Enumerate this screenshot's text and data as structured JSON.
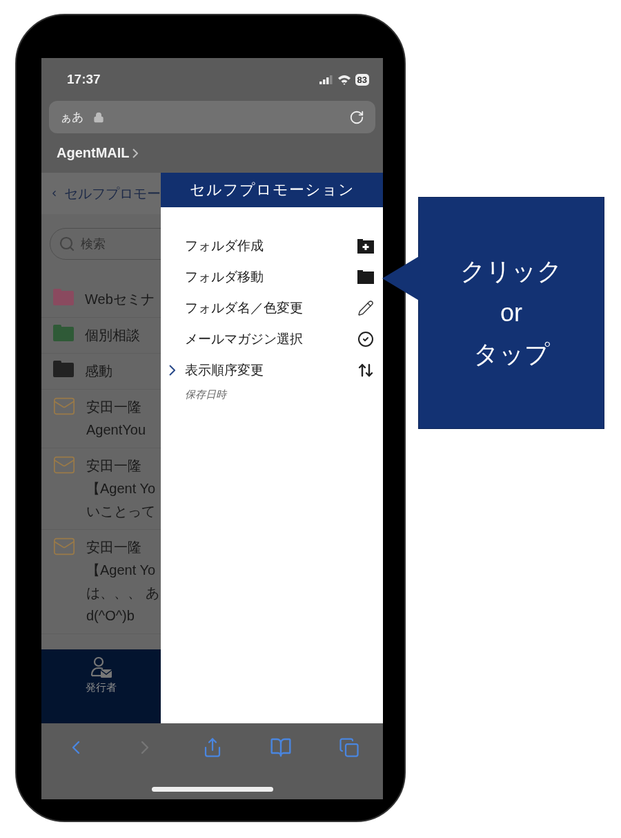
{
  "status_bar": {
    "time": "17:37",
    "battery": "83"
  },
  "browser": {
    "address_text": "ぁあ",
    "back_link": "AgentMAIL"
  },
  "page": {
    "header_title": "セルフプロモー",
    "search": {
      "placeholder": "検索"
    },
    "items": [
      {
        "kind": "folder",
        "color": "#8a4a5f",
        "lines": [
          "Webセミナ"
        ]
      },
      {
        "kind": "folder",
        "color": "#2f5a37",
        "lines": [
          "個別相談"
        ]
      },
      {
        "kind": "folder",
        "color": "#222222",
        "lines": [
          "感動"
        ]
      },
      {
        "kind": "mail",
        "lines": [
          "安田一隆",
          "AgentYou"
        ]
      },
      {
        "kind": "mail",
        "lines": [
          "安田一隆",
          "【Agent Yo",
          "いことって"
        ]
      },
      {
        "kind": "mail",
        "lines": [
          "安田一隆",
          "【Agent Yo",
          "は、、、 あ",
          "d(^O^)b"
        ]
      }
    ],
    "bottom_nav": [
      {
        "label": "発行者"
      }
    ]
  },
  "drawer": {
    "title": "セルフプロモーション",
    "items": [
      {
        "label": "フォルダ作成",
        "selected": false
      },
      {
        "label": "フォルダ移動",
        "selected": false
      },
      {
        "label": "フォルダ名／色変更",
        "selected": false
      },
      {
        "label": "メールマガジン選択",
        "selected": false
      },
      {
        "label": "表示順序変更",
        "selected": true
      }
    ],
    "footer": "保存日時"
  },
  "callout": {
    "lines": [
      "クリック",
      "or",
      "タップ"
    ]
  }
}
